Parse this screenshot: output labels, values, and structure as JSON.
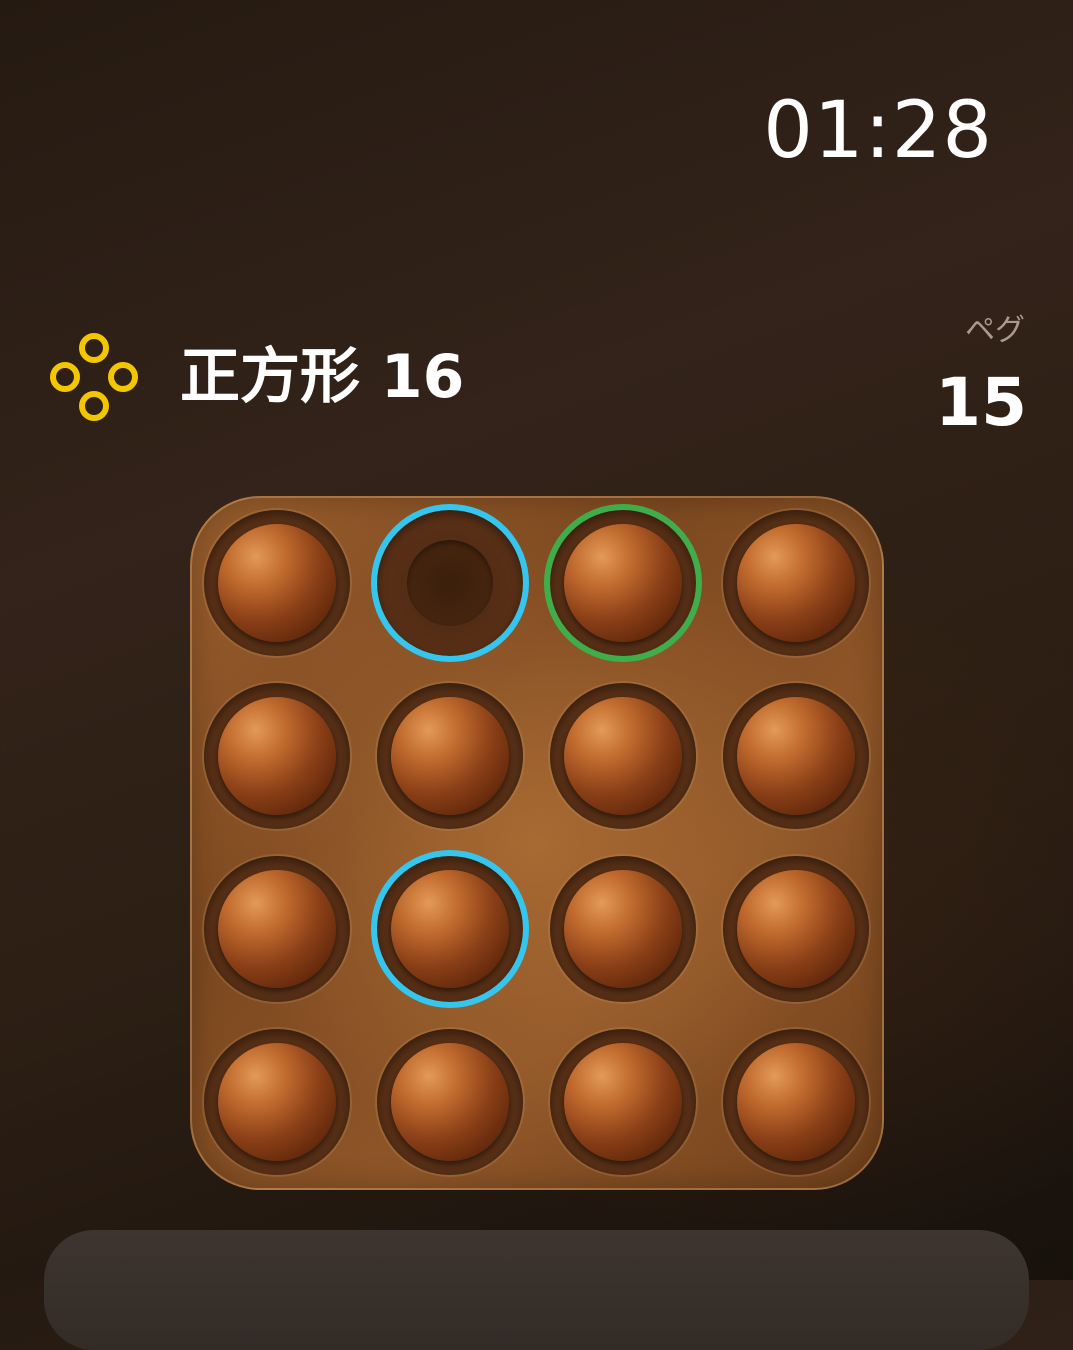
{
  "clock": {
    "time": "01:28"
  },
  "puzzle": {
    "name": "正方形",
    "number": "16",
    "icon": "four-circle-square-icon",
    "icon_color": "#f2c700"
  },
  "pegs": {
    "label": "ペグ",
    "count": "15"
  },
  "board": {
    "rows": 4,
    "cols": 4,
    "cells": [
      [
        {
          "peg": true
        },
        {
          "peg": false,
          "ring": "blue"
        },
        {
          "peg": true,
          "ring": "green"
        },
        {
          "peg": true
        }
      ],
      [
        {
          "peg": true
        },
        {
          "peg": true
        },
        {
          "peg": true
        },
        {
          "peg": true
        }
      ],
      [
        {
          "peg": true
        },
        {
          "peg": true,
          "ring": "blue"
        },
        {
          "peg": true
        },
        {
          "peg": true
        }
      ],
      [
        {
          "peg": true
        },
        {
          "peg": true
        },
        {
          "peg": true
        },
        {
          "peg": true
        }
      ]
    ]
  },
  "colors": {
    "highlight_blue": "#34c6ee",
    "highlight_green": "#3fae4a"
  }
}
